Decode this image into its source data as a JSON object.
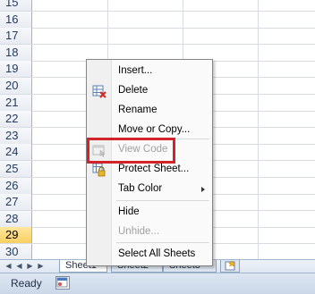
{
  "rows": [
    "15",
    "16",
    "17",
    "18",
    "19",
    "20",
    "21",
    "22",
    "23",
    "24",
    "25",
    "26",
    "27",
    "28",
    "29",
    "30"
  ],
  "selected_row": "29",
  "tabs": [
    "Sheet1",
    "Sheet2",
    "Sheet3"
  ],
  "status": {
    "text": "Ready"
  },
  "context_menu": {
    "insert": "Insert...",
    "delete": "Delete",
    "rename": "Rename",
    "move_copy": "Move or Copy...",
    "view_code": "View Code",
    "protect_sheet": "Protect Sheet...",
    "tab_color": "Tab Color",
    "hide": "Hide",
    "unhide": "Unhide...",
    "select_all": "Select All Sheets"
  },
  "colors": {
    "highlight": "#d2232a",
    "selected_row": "#f8cf61"
  }
}
